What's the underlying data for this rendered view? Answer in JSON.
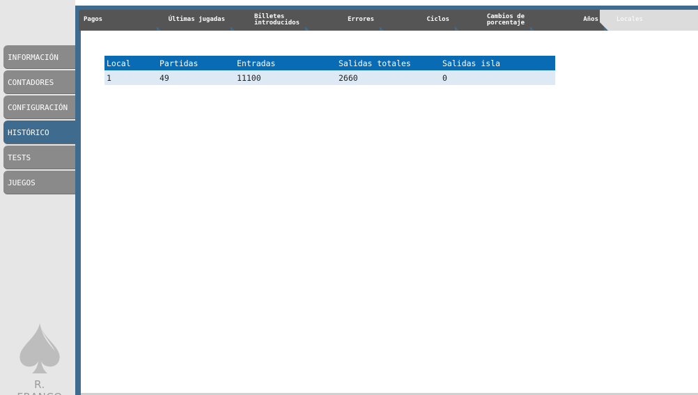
{
  "sidebar": {
    "items": [
      {
        "label": "INFORMACIÓN",
        "active": false
      },
      {
        "label": "CONTADORES",
        "active": false
      },
      {
        "label": "CONFIGURACIÓN",
        "active": false
      },
      {
        "label": "HISTÓRICO",
        "active": true
      },
      {
        "label": "TESTS",
        "active": false
      },
      {
        "label": "JUEGOS",
        "active": false
      }
    ],
    "logo_text": "R. FRANCO"
  },
  "tabs": [
    {
      "label": "Pagos"
    },
    {
      "label": "Últimas jugadas"
    },
    {
      "label": "Billetes\nintroducidos"
    },
    {
      "label": "Errores"
    },
    {
      "label": "Ciclos"
    },
    {
      "label": "Cambios de\nporcentaje"
    },
    {
      "label": "Años"
    },
    {
      "label": "Locales",
      "active": true
    }
  ],
  "table": {
    "headers": [
      "Local",
      "Partidas",
      "Entradas",
      "Salidas totales",
      "Salidas isla"
    ],
    "rows": [
      [
        "1",
        "49",
        "11100",
        "2660",
        "0"
      ]
    ]
  },
  "colors": {
    "accent": "#3f6b8e",
    "header_blue": "#0a6bb5",
    "row_bg": "#dde9f5",
    "tab_bg": "#555555"
  }
}
